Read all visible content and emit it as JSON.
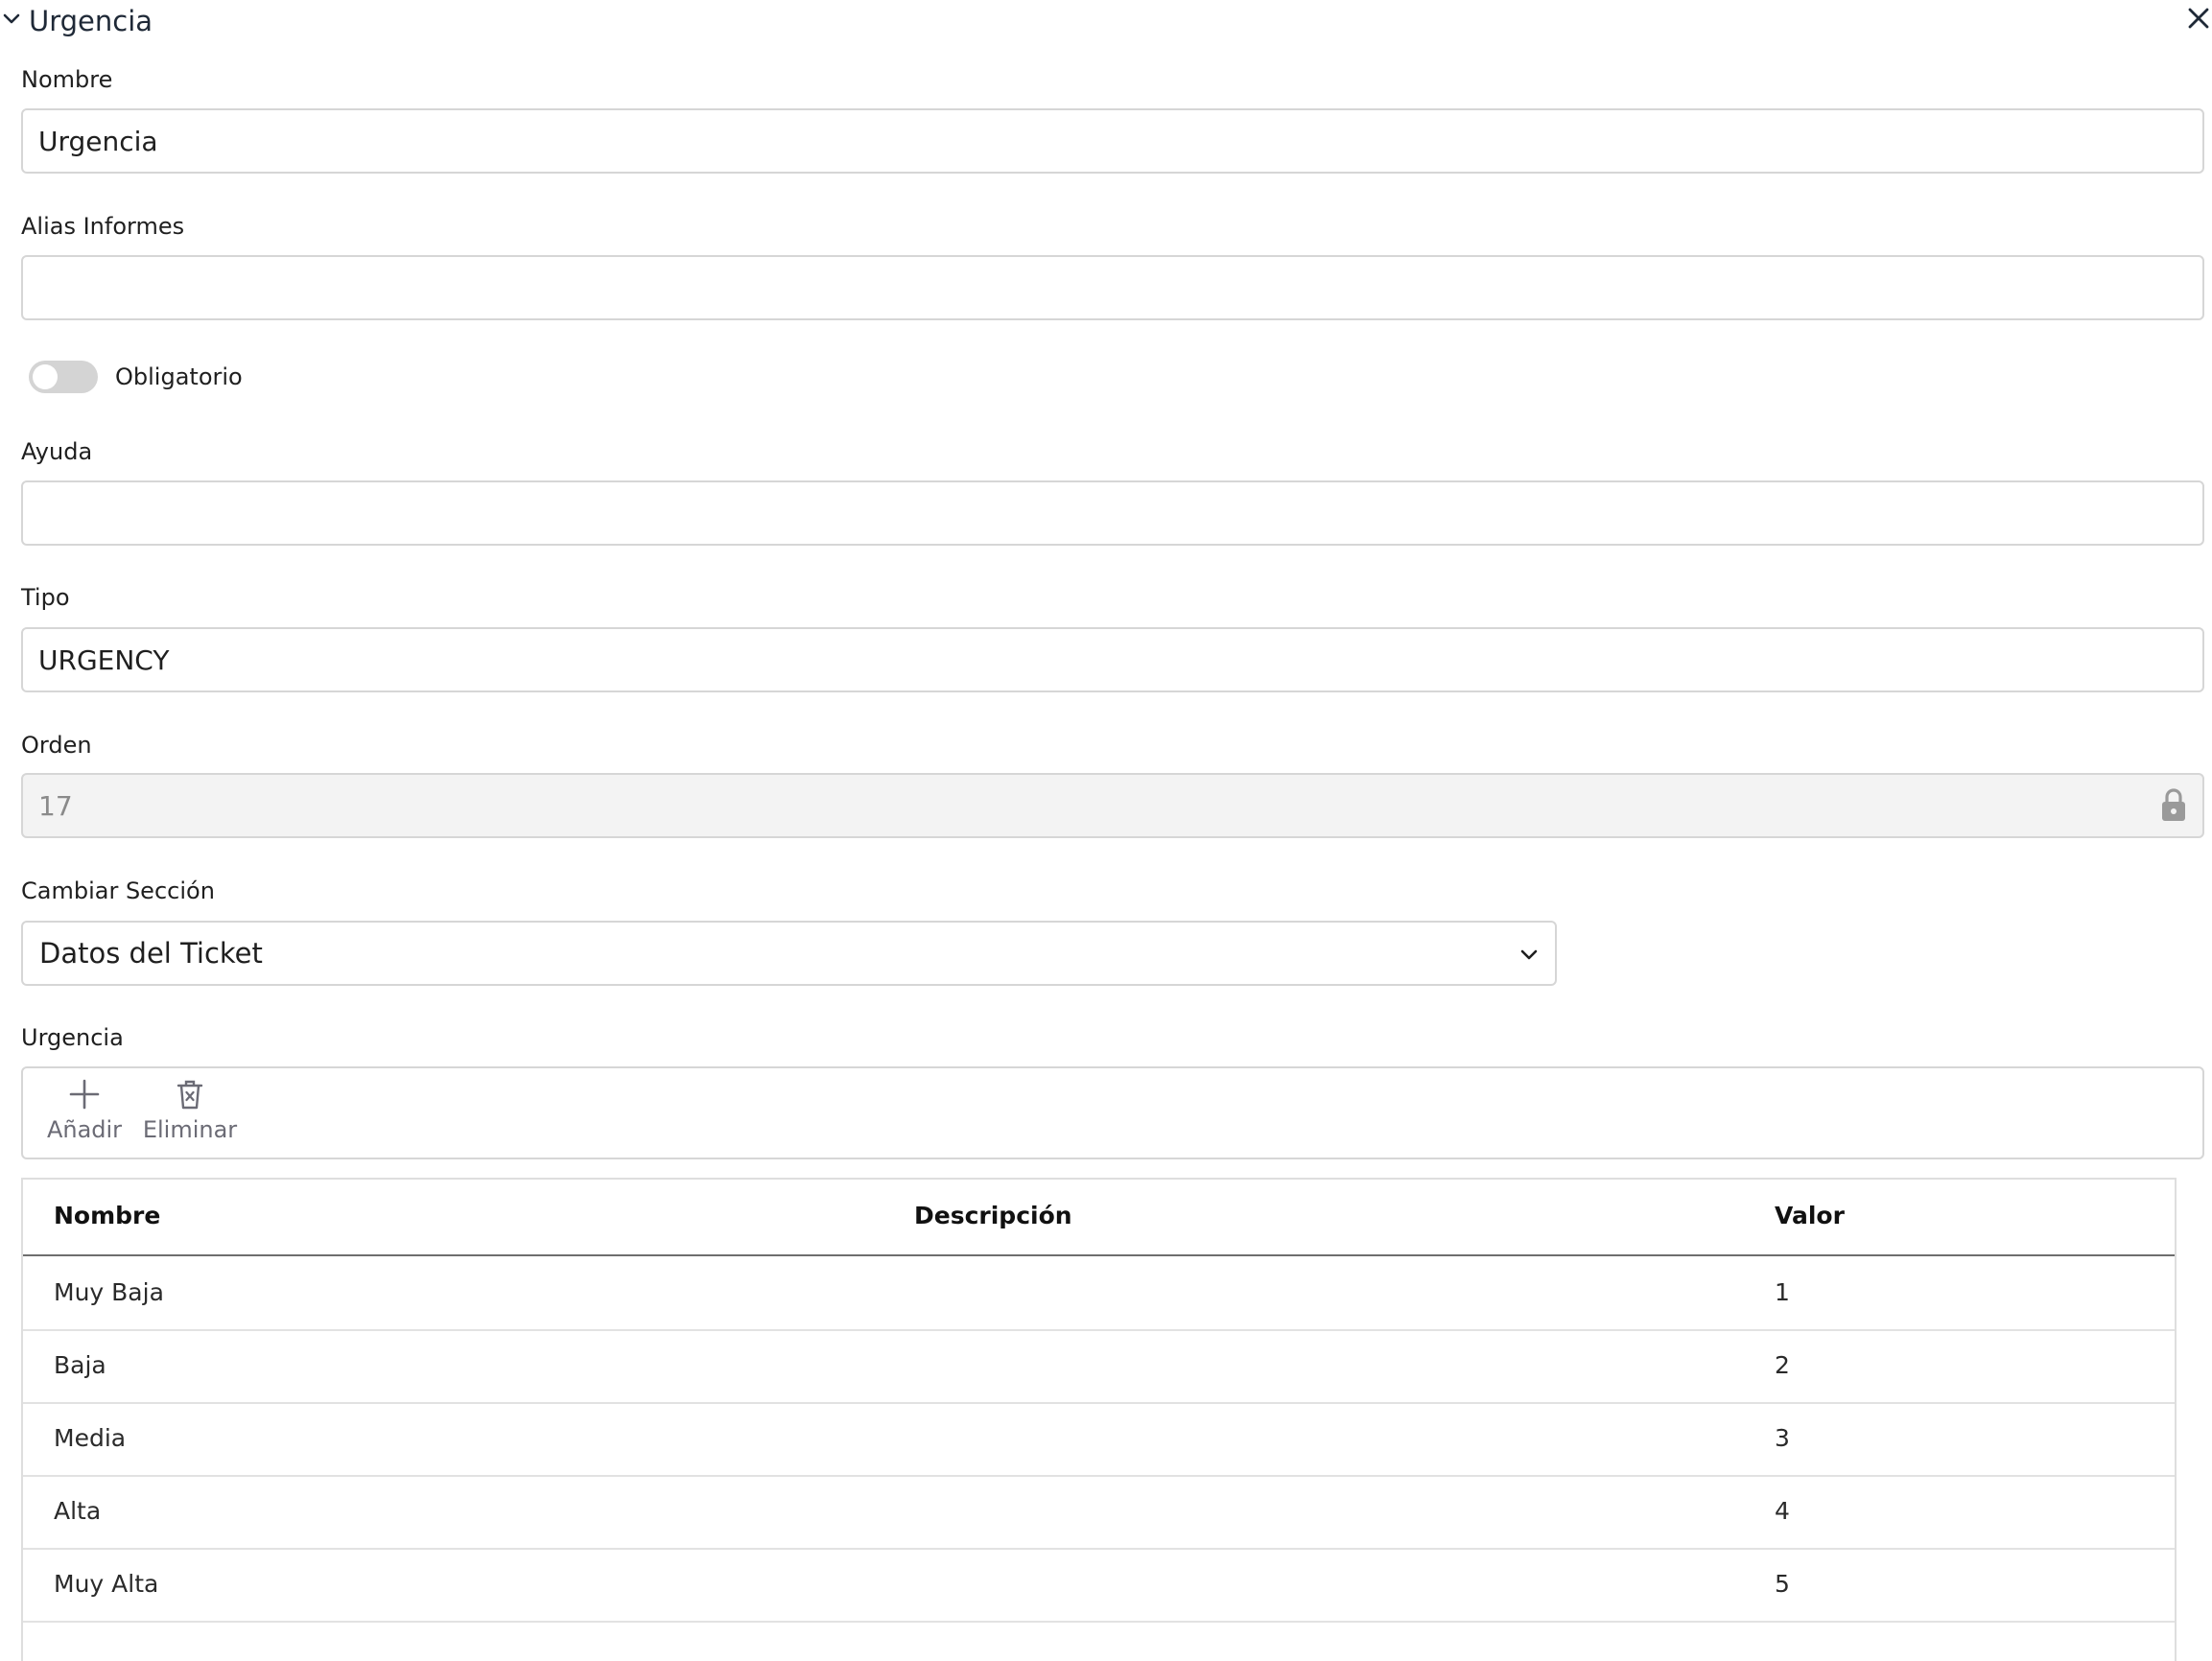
{
  "panel": {
    "title": "Urgencia"
  },
  "fields": {
    "nombre": {
      "label": "Nombre",
      "value": "Urgencia"
    },
    "alias": {
      "label": "Alias Informes",
      "value": ""
    },
    "obligatorio": {
      "label": "Obligatorio",
      "checked": false
    },
    "ayuda": {
      "label": "Ayuda",
      "value": ""
    },
    "tipo": {
      "label": "Tipo",
      "value": "URGENCY"
    },
    "orden": {
      "label": "Orden",
      "value": "17",
      "locked": true
    },
    "seccion": {
      "label": "Cambiar Sección",
      "value": "Datos del Ticket"
    }
  },
  "urgencia_list": {
    "label": "Urgencia",
    "toolbar": {
      "add_label": "Añadir",
      "delete_label": "Eliminar"
    },
    "columns": {
      "nombre": "Nombre",
      "descripcion": "Descripción",
      "valor": "Valor"
    },
    "rows": [
      {
        "nombre": "Muy Baja",
        "descripcion": "",
        "valor": "1"
      },
      {
        "nombre": "Baja",
        "descripcion": "",
        "valor": "2"
      },
      {
        "nombre": "Media",
        "descripcion": "",
        "valor": "3"
      },
      {
        "nombre": "Alta",
        "descripcion": "",
        "valor": "4"
      },
      {
        "nombre": "Muy Alta",
        "descripcion": "",
        "valor": "5"
      }
    ]
  },
  "icons": {
    "collapse": "chevron-down-icon",
    "close": "close-icon",
    "lock": "lock-icon",
    "select": "chevron-down-icon",
    "add": "plus-icon",
    "delete": "trash-icon"
  },
  "colors": {
    "border": "#d6d6d6",
    "locked_bg": "#f3f3f3",
    "toggle_off": "#d4d4d4",
    "toolbar_text": "#6b6b75"
  }
}
